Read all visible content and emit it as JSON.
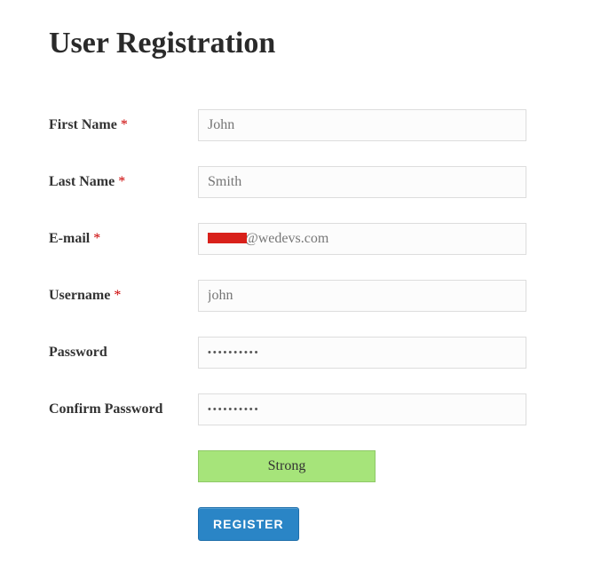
{
  "title": "User Registration",
  "form": {
    "first_name": {
      "label": "First Name",
      "required": "*",
      "placeholder": "John",
      "value": ""
    },
    "last_name": {
      "label": "Last Name",
      "required": "*",
      "placeholder": "Smith",
      "value": ""
    },
    "email": {
      "label": "E-mail",
      "required": "*",
      "redacted_prefix": "████",
      "domain": "@wedevs.com"
    },
    "username": {
      "label": "Username",
      "required": "*",
      "placeholder": "john",
      "value": ""
    },
    "password": {
      "label": "Password",
      "value": "••••••••••"
    },
    "confirm_password": {
      "label": "Confirm Password",
      "value": "••••••••••"
    },
    "strength": {
      "label": "Strong"
    },
    "submit": {
      "label": "REGISTER"
    }
  }
}
